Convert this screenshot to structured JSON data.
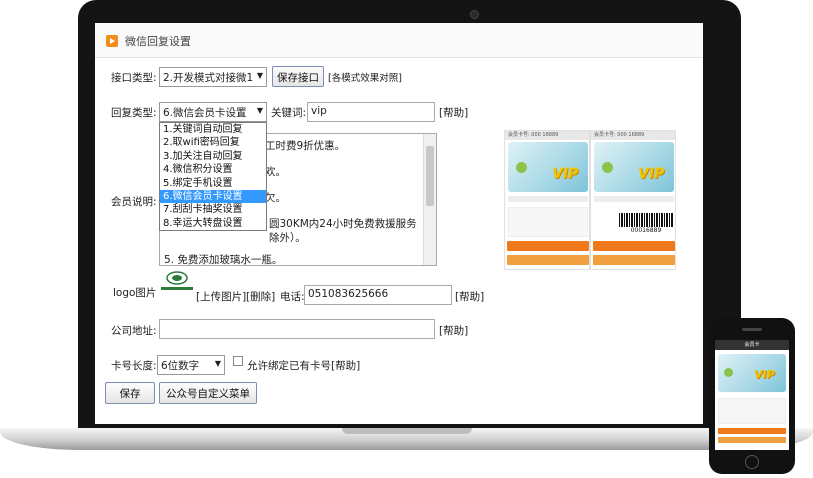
{
  "header": {
    "title": "微信回复设置"
  },
  "interface": {
    "label": "接口类型:",
    "selected": "2.开发模式对接微1",
    "save_button": "保存接口",
    "compare_link": "[各模式效果对照]"
  },
  "reply": {
    "label": "回复类型:",
    "selected": "6.微信会员卡设置",
    "options": [
      "1.关键词自动回复",
      "2.取wifi密码回复",
      "3.加关注自动回复",
      "4.微信积分设置",
      "5.绑定手机设置",
      "6.微信会员卡设置",
      "7.刮刮卡抽奖设置",
      "8.幸运大转盘设置"
    ],
    "highlighted_index": 5,
    "keyword_label": "关键词:",
    "keyword_value": "vip",
    "help": "[帮助]"
  },
  "description": {
    "label": "会员说明:",
    "lines": [
      "工时费9折优惠。",
      "欢。",
      "欠。",
      "圆30KM内24小时免费救援服务",
      "除外）。",
      "5. 免费添加玻璃水一瓶。"
    ]
  },
  "logo": {
    "label": "logo图片",
    "upload": "[上传图片]",
    "delete": "[删除]"
  },
  "phone": {
    "label": "电话:",
    "value": "051083625666",
    "help": "[帮助]"
  },
  "address": {
    "label": "公司地址:",
    "value": "",
    "help": "[帮助]"
  },
  "card_length": {
    "label": "卡号长度:",
    "selected": "6位数字",
    "allow_bind_label": "允许绑定已有卡号",
    "allow_bind_checked": false,
    "help": "[帮助]"
  },
  "actions": {
    "save": "保存",
    "custom_menu": "公众号自定义菜单"
  },
  "preview": {
    "card_no_left": "会员卡号: 000 16889",
    "card_no_right": "会员卡号: 000 16889",
    "vip_text": "VIP",
    "barcode_number": "00016889",
    "phone_nav_title": "会员卡"
  }
}
